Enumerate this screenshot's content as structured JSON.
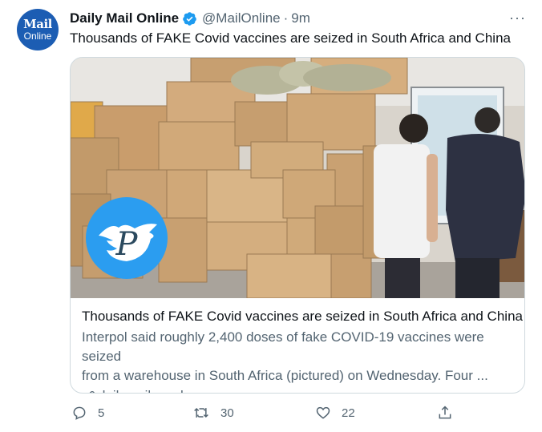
{
  "avatar": {
    "line1": "Mail",
    "line2": "Online"
  },
  "author": {
    "name": "Daily Mail Online",
    "handle": "@MailOnline",
    "separator": "·",
    "time": "9m"
  },
  "more_label": "···",
  "tweet_text": "Thousands of FAKE Covid vaccines are seized in South Africa and China",
  "card": {
    "title": "Thousands of FAKE Covid vaccines are seized in South Africa and China",
    "description_line1": "Interpol said roughly 2,400 doses of fake COVID-19 vaccines were seized",
    "description_line2": "from a warehouse in South Africa (pictured) on Wednesday. Four ...",
    "domain": "dailymail.co.uk"
  },
  "actions": {
    "replies": "5",
    "retweets": "30",
    "likes": "22"
  },
  "colors": {
    "brand": "#1d9bf0",
    "text": "#0f1419",
    "muted": "#536471",
    "avatar": "#1c5db3"
  }
}
